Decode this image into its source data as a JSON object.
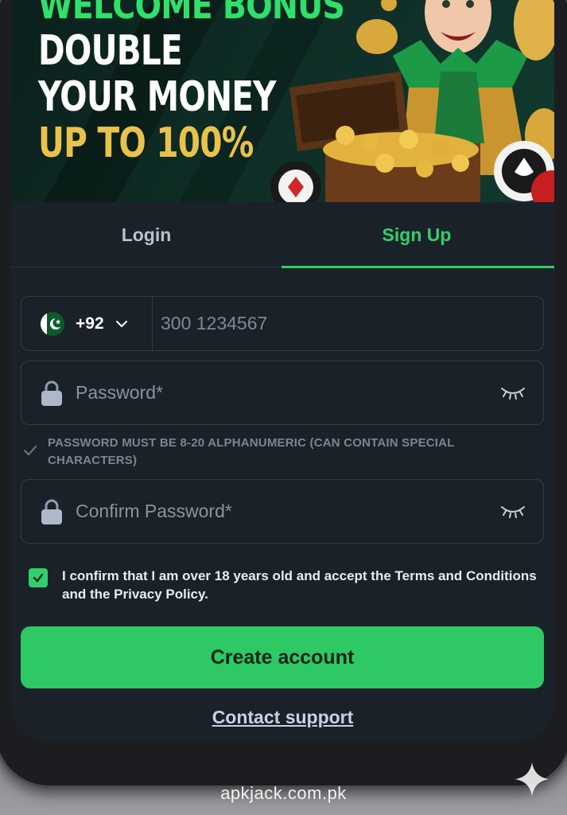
{
  "banner": {
    "line1": "WELCOME BONUS",
    "line2": "DOUBLE",
    "line3": "YOUR MONEY",
    "line4": "UP TO 100%",
    "colors": {
      "green": "#2fe06a",
      "gold": "#e8c24a",
      "white": "#ffffff"
    }
  },
  "tabs": [
    {
      "label": "Login",
      "active": false
    },
    {
      "label": "Sign Up",
      "active": true
    }
  ],
  "phone": {
    "country_code": "+92",
    "flag_icon": "pakistan-flag-icon",
    "placeholder": "300 1234567"
  },
  "password": {
    "placeholder": "Password*",
    "icon": "lock-icon",
    "toggle_icon": "eye-closed-icon"
  },
  "password_hint": "PASSWORD MUST BE 8-20 ALPHANUMERIC (CAN CONTAIN SPECIAL CHARACTERS)",
  "confirm_password": {
    "placeholder": "Confirm Password*"
  },
  "consent": {
    "checked": true,
    "text": "I confirm that I am over 18 years old and accept the Terms and Conditions and the Privacy Policy."
  },
  "create_button": "Create account",
  "contact_link": "Contact support",
  "watermark": "apkjack.com.pk",
  "accent_color": "#2fd16b"
}
